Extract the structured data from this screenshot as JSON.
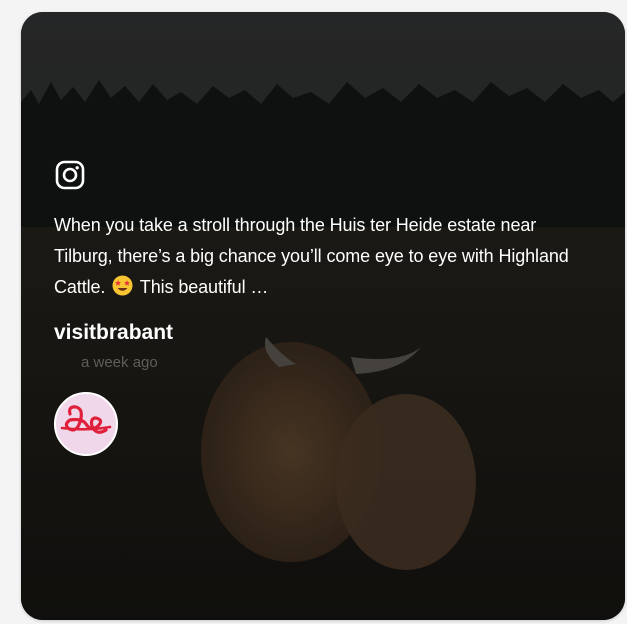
{
  "post": {
    "caption_before_emoji": "When you take a stroll through the Huis ter Heide estate near Tilburg, there’s a big chance you’ll come eye to eye with Highland Cattle.",
    "caption_after_emoji": " This beautiful …",
    "emoji_icon": "star-struck-emoji-icon",
    "username": "visitbrabant",
    "timestamp": "a week ago",
    "platform_icon": "instagram-icon"
  },
  "colors": {
    "avatar_bg": "#f0d8ea",
    "avatar_logo": "#e0203a",
    "timestamp": "#5f5d58"
  }
}
